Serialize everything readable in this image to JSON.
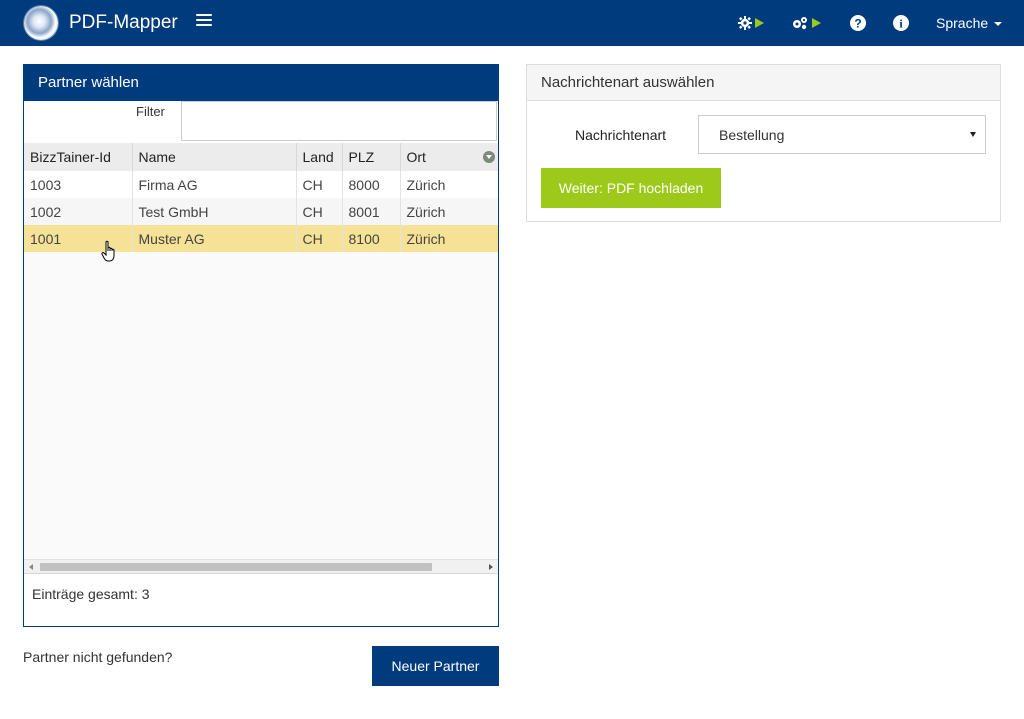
{
  "app": {
    "title": "PDF-Mapper"
  },
  "navbar": {
    "language_label": "Sprache",
    "icons": [
      "hamburger-menu-icon",
      "gear-play-icon",
      "gears-play-icon",
      "help-icon",
      "info-icon"
    ],
    "accent_color": "#9dc91a",
    "bar_color": "#003b7e"
  },
  "partner_panel": {
    "title": "Partner wählen",
    "filter_label": "Filter",
    "filter_value": "",
    "columns": [
      "BizzTainer-Id",
      "Name",
      "Land",
      "PLZ",
      "Ort"
    ],
    "rows": [
      [
        "1003",
        "Firma AG",
        "CH",
        "8000",
        "Zürich"
      ],
      [
        "1002",
        "Test GmbH",
        "CH",
        "8001",
        "Zürich"
      ],
      [
        "1001",
        "Muster AG",
        "CH",
        "8100",
        "Zürich"
      ]
    ],
    "selected_row": 2,
    "footer": "Einträge gesamt: 3"
  },
  "partner_actions": {
    "not_found_text": "Partner nicht gefunden?",
    "new_partner_label": "Neuer Partner"
  },
  "message_panel": {
    "title": "Nachrichtenart auswählen",
    "field_label": "Nachrichtenart",
    "selected_value": "Bestellung",
    "next_label": "Weiter: PDF hochladen"
  }
}
